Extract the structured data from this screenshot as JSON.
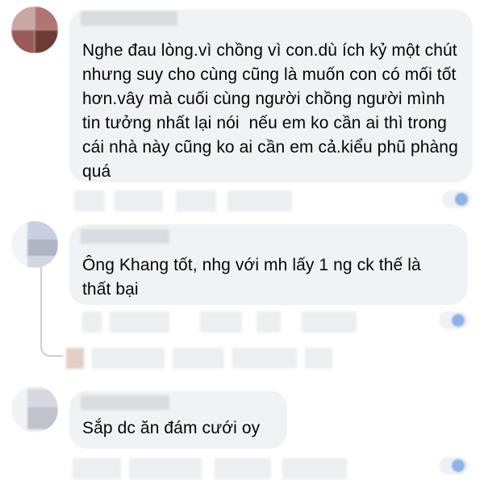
{
  "comments": [
    {
      "text": "Nghe đau lòng.vì chồng vì con.dù ích kỷ một chút nhưng suy cho cùng cũng là muốn con có mối tốt hơn.vây mà cuối cùng người chồng người mình tin tưởng nhất lại nói  nếu em ko cần ai thì trong cái nhà này cũng ko ai cần em cả.kiểu phũ phàng quá"
    },
    {
      "text": "Ông Khang tốt, nhg với mh lấy 1 ng ck thế là thất bại"
    },
    {
      "text": "Sắp dc ăn đám cưới oy"
    }
  ],
  "colors": {
    "bubble": "#f0f2f5",
    "text": "#050505",
    "thread_line": "#ced0d4",
    "reaction": "#8fb1ea"
  }
}
